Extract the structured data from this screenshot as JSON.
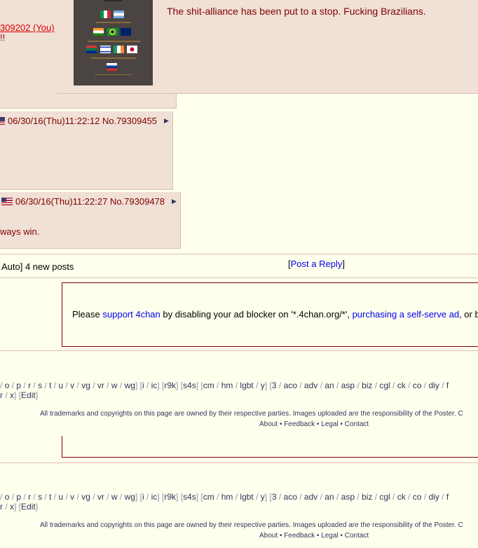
{
  "post_top": {
    "reply_link": "309202 (You)",
    "fragment": "!!",
    "message": "The shit-alliance has been put to a stop. Fucking Brazilians."
  },
  "post2": {
    "date": "06/30/16(Thu)11:22:12",
    "no": "No.79309455"
  },
  "post3": {
    "date": "06/30/16(Thu)11:22:27",
    "no": "No.79309478",
    "message_fragment": "ways win."
  },
  "thread_stats": {
    "fragment": "Auto] 4 new posts"
  },
  "post_reply": {
    "open": "[",
    "label": "Post a Reply",
    "close": "]"
  },
  "ad_notice": {
    "pre": "Please ",
    "link1": "support 4chan",
    "mid": " by disabling your ad blocker on '*.4chan.org/*', ",
    "link2": "purchasing a self-serve ad",
    "post": ", or b"
  },
  "board_nav": {
    "line1": [
      {
        "t": " / ",
        "link": false
      },
      {
        "t": "o",
        "link": true
      },
      {
        "t": " / ",
        "link": false
      },
      {
        "t": "p",
        "link": true
      },
      {
        "t": " / ",
        "link": false
      },
      {
        "t": "r",
        "link": true
      },
      {
        "t": " / ",
        "link": false
      },
      {
        "t": "s",
        "link": true
      },
      {
        "t": " / ",
        "link": false
      },
      {
        "t": "t",
        "link": true
      },
      {
        "t": " / ",
        "link": false
      },
      {
        "t": "u",
        "link": true
      },
      {
        "t": " / ",
        "link": false
      },
      {
        "t": "v",
        "link": true
      },
      {
        "t": " / ",
        "link": false
      },
      {
        "t": "vg",
        "link": true
      },
      {
        "t": " / ",
        "link": false
      },
      {
        "t": "vr",
        "link": true
      },
      {
        "t": " / ",
        "link": false
      },
      {
        "t": "w",
        "link": true
      },
      {
        "t": " / ",
        "link": false
      },
      {
        "t": "wg",
        "link": true
      },
      {
        "t": "] [",
        "link": false
      },
      {
        "t": "i",
        "link": true
      },
      {
        "t": " / ",
        "link": false
      },
      {
        "t": "ic",
        "link": true
      },
      {
        "t": "] [",
        "link": false
      },
      {
        "t": "r9k",
        "link": true
      },
      {
        "t": "] [",
        "link": false
      },
      {
        "t": "s4s",
        "link": true
      },
      {
        "t": "] [",
        "link": false
      },
      {
        "t": "cm",
        "link": true
      },
      {
        "t": " / ",
        "link": false
      },
      {
        "t": "hm",
        "link": true
      },
      {
        "t": " / ",
        "link": false
      },
      {
        "t": "lgbt",
        "link": true
      },
      {
        "t": " / ",
        "link": false
      },
      {
        "t": "y",
        "link": true
      },
      {
        "t": "] [",
        "link": false
      },
      {
        "t": "3",
        "link": true
      },
      {
        "t": " / ",
        "link": false
      },
      {
        "t": "aco",
        "link": true
      },
      {
        "t": " / ",
        "link": false
      },
      {
        "t": "adv",
        "link": true
      },
      {
        "t": " / ",
        "link": false
      },
      {
        "t": "an",
        "link": true
      },
      {
        "t": " / ",
        "link": false
      },
      {
        "t": "asp",
        "link": true
      },
      {
        "t": " / ",
        "link": false
      },
      {
        "t": "biz",
        "link": true
      },
      {
        "t": " / ",
        "link": false
      },
      {
        "t": "cgl",
        "link": true
      },
      {
        "t": " / ",
        "link": false
      },
      {
        "t": "ck",
        "link": true
      },
      {
        "t": " / ",
        "link": false
      },
      {
        "t": "co",
        "link": true
      },
      {
        "t": " / ",
        "link": false
      },
      {
        "t": "diy",
        "link": true
      },
      {
        "t": " / ",
        "link": false
      },
      {
        "t": "f",
        "link": true
      }
    ],
    "line2": [
      {
        "t": "r",
        "link": true
      },
      {
        "t": " / ",
        "link": false
      },
      {
        "t": "x",
        "link": true
      },
      {
        "t": "] [",
        "link": false
      },
      {
        "t": "Edit",
        "link": true
      },
      {
        "t": "]",
        "link": false
      }
    ]
  },
  "footer": {
    "disclaimer": "All trademarks and copyrights on this page are owned by their respective parties. Images uploaded are the responsibility of the Poster. C",
    "links": [
      "About",
      "Feedback",
      "Legal",
      "Contact"
    ],
    "sep": " • "
  },
  "flags": [
    "italy",
    "argentina",
    "india",
    "brazil",
    "australia",
    "south-africa",
    "israel",
    "ireland",
    "japan",
    "russia"
  ],
  "colors": {
    "post_bg": "#f0e0d6",
    "page_bg": "#ffffee",
    "text": "#800000",
    "link": "#0000ee",
    "quote_link": "#dd0000"
  }
}
